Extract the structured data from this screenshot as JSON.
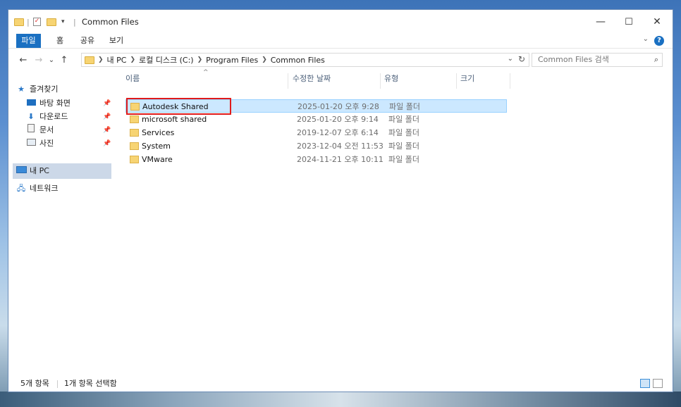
{
  "window": {
    "title": "Common Files",
    "controls": {
      "minimize": "—",
      "maximize": "☐",
      "close": "✕"
    }
  },
  "ribbon": {
    "tabs": [
      "파일",
      "홈",
      "공유",
      "보기"
    ],
    "help": "?"
  },
  "nav": {
    "back": "←",
    "forward": "→",
    "recent": "⌄",
    "up": "↑"
  },
  "address": {
    "segments": [
      "내 PC",
      "로컬 디스크 (C:)",
      "Program Files",
      "Common Files"
    ]
  },
  "search": {
    "placeholder": "Common Files 검색"
  },
  "sidebar": {
    "quick_access": "즐겨찾기",
    "items": [
      {
        "label": "바탕 화면",
        "icon": "desktop-icon"
      },
      {
        "label": "다운로드",
        "icon": "download-icon"
      },
      {
        "label": "문서",
        "icon": "document-icon"
      },
      {
        "label": "사진",
        "icon": "picture-icon"
      }
    ],
    "this_pc": "내 PC",
    "network": "네트워크"
  },
  "columns": {
    "name": "이름",
    "modified": "수정한 날짜",
    "type": "유형",
    "size": "크기"
  },
  "files": [
    {
      "name": "Autodesk Shared",
      "modified": "2025-01-20 오후 9:28",
      "type": "파일 폴더",
      "selected": true
    },
    {
      "name": "microsoft shared",
      "modified": "2025-01-20 오후 9:14",
      "type": "파일 폴더",
      "selected": false
    },
    {
      "name": "Services",
      "modified": "2019-12-07 오후 6:14",
      "type": "파일 폴더",
      "selected": false
    },
    {
      "name": "System",
      "modified": "2023-12-04 오전 11:53",
      "type": "파일 폴더",
      "selected": false
    },
    {
      "name": "VMware",
      "modified": "2024-11-21 오후 10:11",
      "type": "파일 폴더",
      "selected": false
    }
  ],
  "status": {
    "count": "5개 항목",
    "selection": "1개 항목 선택함"
  },
  "colors": {
    "accent": "#1a70c2",
    "selection": "#cce8ff",
    "highlight_box": "#e01b1b"
  }
}
